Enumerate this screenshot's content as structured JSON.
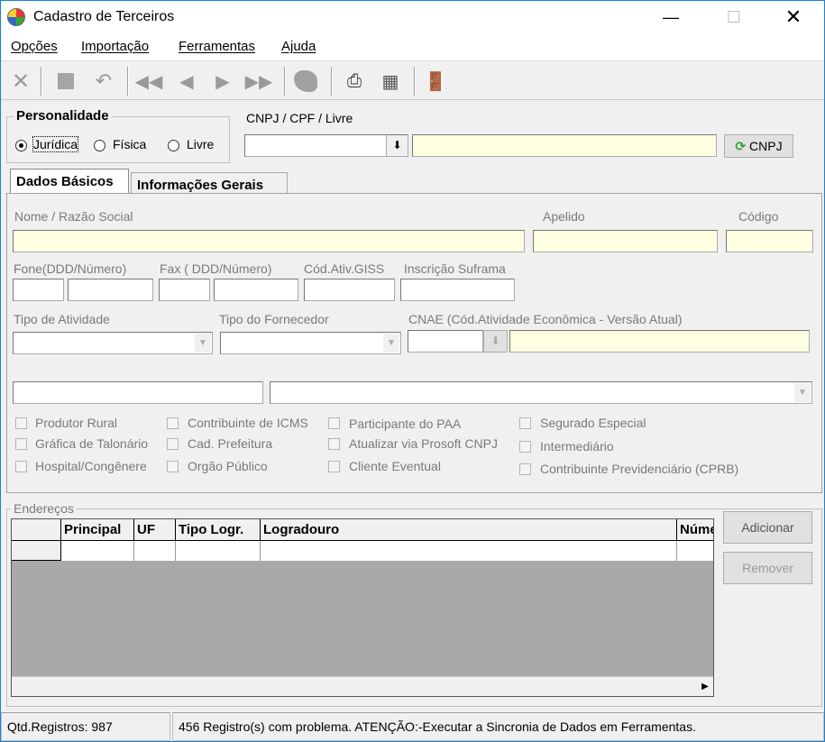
{
  "window": {
    "title": "Cadastro de Terceiros"
  },
  "menu": [
    "Opções",
    "Importação",
    "Ferramentas",
    "Ajuda"
  ],
  "toolbar_icons": [
    "close-icon",
    "stop-icon",
    "undo-icon",
    "first-record-icon",
    "prev-record-icon",
    "next-record-icon",
    "last-record-icon",
    "brazil-map-icon",
    "print-icon",
    "print-preview-icon",
    "exit-door-icon"
  ],
  "personalidade": {
    "title": "Personalidade",
    "options": [
      "Jurídica",
      "Física",
      "Livre"
    ],
    "selected": "Jurídica"
  },
  "doc": {
    "label": "CNPJ / CPF / Livre",
    "cnpj_button": "CNPJ"
  },
  "tabs": [
    "Dados Básicos",
    "Informações Gerais"
  ],
  "form": {
    "nome_label": "Nome / Razão Social",
    "apelido_label": "Apelido",
    "codigo_label": "Código",
    "fone_label": "Fone(DDD/Número)",
    "fax_label": "Fax ( DDD/Número)",
    "cod_ativ_label": "Cód.Ativ.GISS",
    "suframa_label": "Inscrição Suframa",
    "tipo_atividade_label": "Tipo de Atividade",
    "tipo_fornecedor_label": "Tipo do Fornecedor",
    "cnae_label": "CNAE (Cód.Atividade Econômica - Versão Atual)"
  },
  "checkboxes": {
    "col1": [
      "Produtor Rural",
      "Gráfica de Talonário",
      "Hospital/Congênere"
    ],
    "col2": [
      "Contribuinte de ICMS",
      "Cad. Prefeitura",
      "Orgão Público"
    ],
    "col3": [
      "Participante do PAA",
      "Atualizar via Prosoft CNPJ",
      "Cliente Eventual"
    ],
    "col4": [
      "Segurado Especial",
      "Intermediário",
      "Contribuinte Previdenciário (CPRB)"
    ]
  },
  "enderecos": {
    "title": "Endereços",
    "columns": [
      "Principal",
      "UF",
      "Tipo Logr.",
      "Logradouro",
      "Núme"
    ],
    "add_button": "Adicionar",
    "remove_button": "Remover"
  },
  "status": {
    "count": "Qtd.Registros: 987",
    "message": "456  Registro(s) com problema. ATENÇÃO:-Executar a Sincronia de Dados em Ferramentas."
  }
}
